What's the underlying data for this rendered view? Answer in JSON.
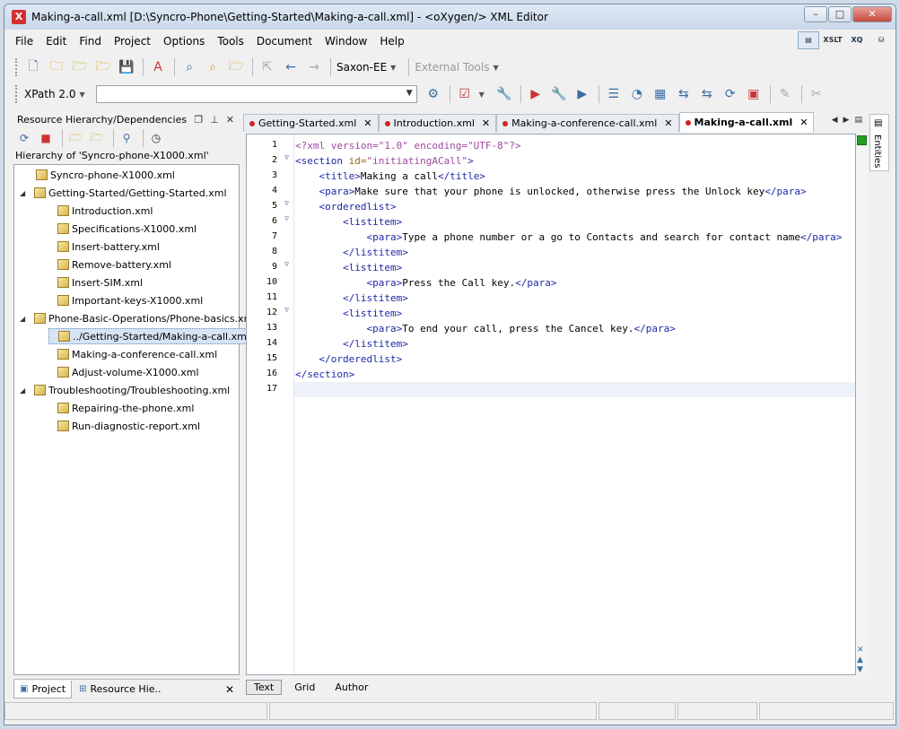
{
  "window": {
    "title": "Making-a-call.xml [D:\\Syncro-Phone\\Getting-Started\\Making-a-call.xml] - <oXygen/> XML Editor",
    "minimize": "–",
    "maximize": "□",
    "close": "✕"
  },
  "menu": [
    "File",
    "Edit",
    "Find",
    "Project",
    "Options",
    "Tools",
    "Document",
    "Window",
    "Help"
  ],
  "perspectives": [
    "XSLT",
    "XQ"
  ],
  "toolbar1": {
    "transformer": "Saxon-EE",
    "external_tools": "External Tools"
  },
  "toolbar2": {
    "xpath_version": "XPath 2.0",
    "xpath_value": ""
  },
  "left_panel": {
    "title": "Resource Hierarchy/Dependencies",
    "caption": "Hierarchy of 'Syncro-phone-X1000.xml'",
    "tree": [
      {
        "label": "Syncro-phone-X1000.xml",
        "level": 0,
        "toggle": ""
      },
      {
        "label": "Getting-Started/Getting-Started.xml",
        "level": 1,
        "toggle": "◢"
      },
      {
        "label": "Introduction.xml",
        "level": 2,
        "toggle": ""
      },
      {
        "label": "Specifications-X1000.xml",
        "level": 2,
        "toggle": ""
      },
      {
        "label": "Insert-battery.xml",
        "level": 2,
        "toggle": ""
      },
      {
        "label": "Remove-battery.xml",
        "level": 2,
        "toggle": ""
      },
      {
        "label": "Insert-SIM.xml",
        "level": 2,
        "toggle": ""
      },
      {
        "label": "Important-keys-X1000.xml",
        "level": 2,
        "toggle": ""
      },
      {
        "label": "Phone-Basic-Operations/Phone-basics.xml",
        "level": 1,
        "toggle": "◢"
      },
      {
        "label": "../Getting-Started/Making-a-call.xml",
        "level": 2,
        "toggle": "",
        "selected": true
      },
      {
        "label": "Making-a-conference-call.xml",
        "level": 2,
        "toggle": ""
      },
      {
        "label": "Adjust-volume-X1000.xml",
        "level": 2,
        "toggle": ""
      },
      {
        "label": "Troubleshooting/Troubleshooting.xml",
        "level": 1,
        "toggle": "◢"
      },
      {
        "label": "Repairing-the-phone.xml",
        "level": 2,
        "toggle": ""
      },
      {
        "label": "Run-diagnostic-report.xml",
        "level": 2,
        "toggle": ""
      }
    ],
    "bottom_tabs": [
      "Project",
      "Resource Hie.."
    ]
  },
  "editor": {
    "tabs": [
      {
        "label": "Getting-Started.xml",
        "active": false
      },
      {
        "label": "Introduction.xml",
        "active": false
      },
      {
        "label": "Making-a-conference-call.xml",
        "active": false
      },
      {
        "label": "Making-a-call.xml",
        "active": true
      }
    ],
    "lines": [
      {
        "n": "1",
        "fold": "",
        "html": "<span class='t-pi'>&lt;?xml version=\"1.0\" encoding=\"UTF-8\"?&gt;</span>"
      },
      {
        "n": "2",
        "fold": "▽",
        "html": "<span class='t-tag'>&lt;section</span> <span class='t-attr'>id=</span><span class='t-val'>\"initiatingACall\"</span><span class='t-tag'>&gt;</span>"
      },
      {
        "n": "3",
        "fold": "",
        "html": "    <span class='t-tag'>&lt;title&gt;</span>Making a call<span class='t-tag'>&lt;/title&gt;</span>"
      },
      {
        "n": "4",
        "fold": "",
        "html": "    <span class='t-tag'>&lt;para&gt;</span>Make sure that your phone is unlocked, otherwise press the Unlock key<span class='t-tag'>&lt;/para&gt;</span>"
      },
      {
        "n": "5",
        "fold": "▽",
        "html": "    <span class='t-tag'>&lt;orderedlist&gt;</span>"
      },
      {
        "n": "6",
        "fold": "▽",
        "html": "        <span class='t-tag'>&lt;listitem&gt;</span>"
      },
      {
        "n": "7",
        "fold": "",
        "html": "            <span class='t-tag'>&lt;para&gt;</span>Type a phone number or a go to Contacts and search for contact name<span class='t-tag'>&lt;/para&gt;</span>"
      },
      {
        "n": "8",
        "fold": "",
        "html": "        <span class='t-tag'>&lt;/listitem&gt;</span>"
      },
      {
        "n": "9",
        "fold": "▽",
        "html": "        <span class='t-tag'>&lt;listitem&gt;</span>"
      },
      {
        "n": "10",
        "fold": "",
        "html": "            <span class='t-tag'>&lt;para&gt;</span>Press the Call key.<span class='t-tag'>&lt;/para&gt;</span>"
      },
      {
        "n": "11",
        "fold": "",
        "html": "        <span class='t-tag'>&lt;/listitem&gt;</span>"
      },
      {
        "n": "12",
        "fold": "▽",
        "html": "        <span class='t-tag'>&lt;listitem&gt;</span>"
      },
      {
        "n": "13",
        "fold": "",
        "html": "            <span class='t-tag'>&lt;para&gt;</span>To end your call, press the Cancel key.<span class='t-tag'>&lt;/para&gt;</span>"
      },
      {
        "n": "14",
        "fold": "",
        "html": "        <span class='t-tag'>&lt;/listitem&gt;</span>"
      },
      {
        "n": "15",
        "fold": "",
        "html": "    <span class='t-tag'>&lt;/orderedlist&gt;</span>"
      },
      {
        "n": "16",
        "fold": "",
        "html": "<span class='t-tag'>&lt;/section&gt;</span>"
      },
      {
        "n": "17",
        "fold": "",
        "html": ""
      }
    ],
    "current_line": "17",
    "modes": [
      "Text",
      "Grid",
      "Author"
    ],
    "active_mode": "Text"
  },
  "side_tab": "Entities",
  "colors": {
    "tag": "#1f28a8",
    "attr": "#a0691c",
    "pi": "#a048a0",
    "unsaved_dot": "#d32020",
    "ok_marker": "#22a022"
  }
}
